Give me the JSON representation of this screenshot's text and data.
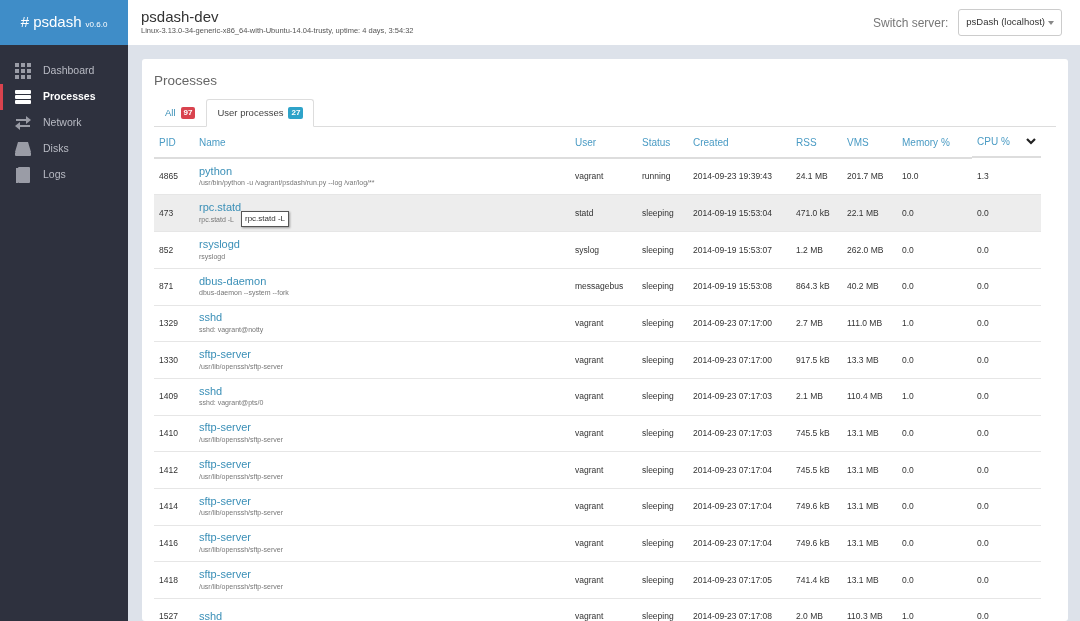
{
  "brand": {
    "name": "# psdash",
    "version": "v0.6.0"
  },
  "sidebar": {
    "items": [
      {
        "label": "Dashboard",
        "selected": false
      },
      {
        "label": "Processes",
        "selected": true
      },
      {
        "label": "Network",
        "selected": false
      },
      {
        "label": "Disks",
        "selected": false
      },
      {
        "label": "Logs",
        "selected": false
      }
    ]
  },
  "header": {
    "title": "psdash-dev",
    "subtitle": "Linux-3.13.0-34-generic-x86_64-with-Ubuntu-14.04-trusty, uptime: 4 days, 3:54:32",
    "switch_label": "Switch server:",
    "server": "psDash (localhost)"
  },
  "panel": {
    "title": "Processes"
  },
  "tabs": [
    {
      "label": "All",
      "count": "97",
      "color": "#d9434e",
      "selected": false
    },
    {
      "label": "User processes",
      "count": "27",
      "color": "#2ea3c9",
      "selected": true
    }
  ],
  "table": {
    "columns": [
      "PID",
      "Name",
      "User",
      "Status",
      "Created",
      "RSS",
      "VMS",
      "Memory %",
      "CPU %"
    ],
    "rows": [
      {
        "pid": "4865",
        "name": "python",
        "cmdline": "/usr/bin/python -u /vagrant/psdash/run.py --log /var/log/**",
        "user": "vagrant",
        "status": "running",
        "created": "2014-09-23 19:39:43",
        "rss": "24.1 MB",
        "vms": "201.7 MB",
        "memory": "10.0",
        "cpu": "1.3",
        "hovered": false
      },
      {
        "pid": "473",
        "name": "rpc.statd",
        "cmdline": "rpc.statd -L",
        "tooltip": "rpc.statd -L",
        "user": "statd",
        "status": "sleeping",
        "created": "2014-09-19 15:53:04",
        "rss": "471.0 kB",
        "vms": "22.1 MB",
        "memory": "0.0",
        "cpu": "0.0",
        "hovered": true
      },
      {
        "pid": "852",
        "name": "rsyslogd",
        "cmdline": "rsyslogd",
        "user": "syslog",
        "status": "sleeping",
        "created": "2014-09-19 15:53:07",
        "rss": "1.2 MB",
        "vms": "262.0 MB",
        "memory": "0.0",
        "cpu": "0.0",
        "hovered": false
      },
      {
        "pid": "871",
        "name": "dbus-daemon",
        "cmdline": "dbus-daemon --system --fork",
        "user": "messagebus",
        "status": "sleeping",
        "created": "2014-09-19 15:53:08",
        "rss": "864.3 kB",
        "vms": "40.2 MB",
        "memory": "0.0",
        "cpu": "0.0",
        "hovered": false
      },
      {
        "pid": "1329",
        "name": "sshd",
        "cmdline": "sshd: vagrant@notty",
        "user": "vagrant",
        "status": "sleeping",
        "created": "2014-09-23 07:17:00",
        "rss": "2.7 MB",
        "vms": "111.0 MB",
        "memory": "1.0",
        "cpu": "0.0",
        "hovered": false
      },
      {
        "pid": "1330",
        "name": "sftp-server",
        "cmdline": "/usr/lib/openssh/sftp-server",
        "user": "vagrant",
        "status": "sleeping",
        "created": "2014-09-23 07:17:00",
        "rss": "917.5 kB",
        "vms": "13.3 MB",
        "memory": "0.0",
        "cpu": "0.0",
        "hovered": false
      },
      {
        "pid": "1409",
        "name": "sshd",
        "cmdline": "sshd: vagrant@pts/0",
        "user": "vagrant",
        "status": "sleeping",
        "created": "2014-09-23 07:17:03",
        "rss": "2.1 MB",
        "vms": "110.4 MB",
        "memory": "1.0",
        "cpu": "0.0",
        "hovered": false
      },
      {
        "pid": "1410",
        "name": "sftp-server",
        "cmdline": "/usr/lib/openssh/sftp-server",
        "user": "vagrant",
        "status": "sleeping",
        "created": "2014-09-23 07:17:03",
        "rss": "745.5 kB",
        "vms": "13.1 MB",
        "memory": "0.0",
        "cpu": "0.0",
        "hovered": false
      },
      {
        "pid": "1412",
        "name": "sftp-server",
        "cmdline": "/usr/lib/openssh/sftp-server",
        "user": "vagrant",
        "status": "sleeping",
        "created": "2014-09-23 07:17:04",
        "rss": "745.5 kB",
        "vms": "13.1 MB",
        "memory": "0.0",
        "cpu": "0.0",
        "hovered": false
      },
      {
        "pid": "1414",
        "name": "sftp-server",
        "cmdline": "/usr/lib/openssh/sftp-server",
        "user": "vagrant",
        "status": "sleeping",
        "created": "2014-09-23 07:17:04",
        "rss": "749.6 kB",
        "vms": "13.1 MB",
        "memory": "0.0",
        "cpu": "0.0",
        "hovered": false
      },
      {
        "pid": "1416",
        "name": "sftp-server",
        "cmdline": "/usr/lib/openssh/sftp-server",
        "user": "vagrant",
        "status": "sleeping",
        "created": "2014-09-23 07:17:04",
        "rss": "749.6 kB",
        "vms": "13.1 MB",
        "memory": "0.0",
        "cpu": "0.0",
        "hovered": false
      },
      {
        "pid": "1418",
        "name": "sftp-server",
        "cmdline": "/usr/lib/openssh/sftp-server",
        "user": "vagrant",
        "status": "sleeping",
        "created": "2014-09-23 07:17:05",
        "rss": "741.4 kB",
        "vms": "13.1 MB",
        "memory": "0.0",
        "cpu": "0.0",
        "hovered": false
      },
      {
        "pid": "1527",
        "name": "sshd",
        "user": "vagrant",
        "status": "sleeping",
        "created": "2014-09-23 07:17:08",
        "rss": "2.0 MB",
        "vms": "110.3 MB",
        "memory": "1.0",
        "cpu": "0.0",
        "hovered": false
      }
    ]
  }
}
